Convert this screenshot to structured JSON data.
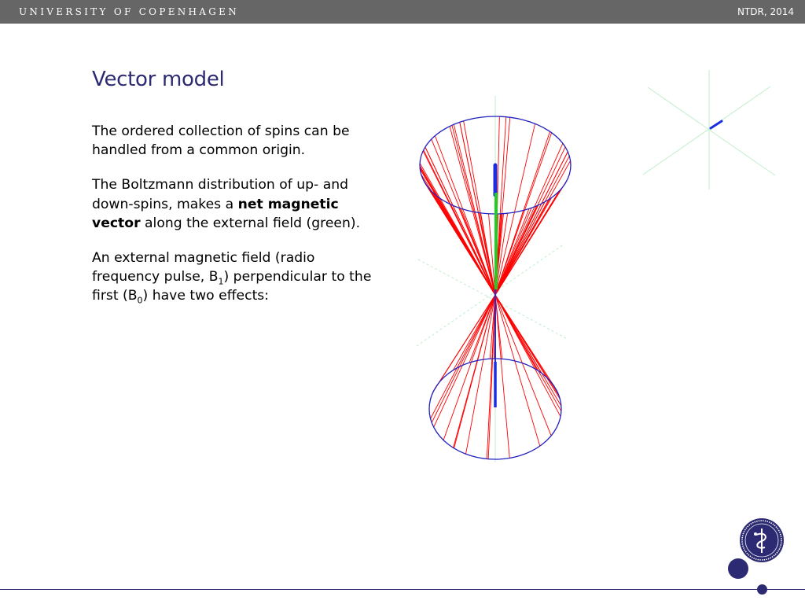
{
  "header": {
    "university": "UNIVERSITY OF COPENHAGEN",
    "right_text": "NTDR, 2014"
  },
  "slide": {
    "title": "Vector model",
    "paragraph1": "The ordered collection of spins can be handled from a common origin.",
    "paragraph2": {
      "before": "The Boltzmann distribution of up- and down-spins, makes a ",
      "bold": "net magnetic vector",
      "after": " along the external field (green)."
    },
    "paragraph3": {
      "part1": "An external magnetic field (radio frequency pulse, B",
      "sub1": "1",
      "part2": ") perpendicular to the first (B",
      "sub2": "0",
      "part3": ") have two effects:"
    }
  },
  "figure": {
    "up_spin_count": 70,
    "down_spin_count": 30,
    "colors": {
      "spin": "#ff0000",
      "cone_rim": "#2020c0",
      "net_vector": "#22cc22",
      "axis": "#1a2ee0",
      "guide": "#bfeecb"
    }
  },
  "brand": {
    "primary": "#2c2a72",
    "header_bg": "#666666"
  }
}
